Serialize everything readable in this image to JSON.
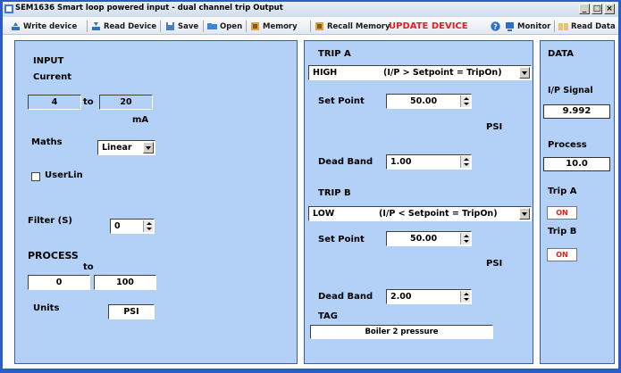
{
  "window": {
    "title": "SEM1636 Smart loop powered input - dual channel trip Output"
  },
  "toolbar": {
    "write_device": "Write device",
    "read_device": "Read Device",
    "save": "Save",
    "open": "Open",
    "memory": "Memory",
    "recall_memory": "Recall Memory",
    "update_device": "UPDATE DEVICE",
    "monitor": "Monitor",
    "read_data": "Read Data"
  },
  "input": {
    "heading": "INPUT",
    "type": "Current",
    "range_low": "4",
    "to_label": "to",
    "range_high": "20",
    "unit": "mA",
    "maths_label": "Maths",
    "maths_value": "Linear",
    "userlin_label": "UserLin",
    "filter_label": "Filter (S)",
    "filter_value": "0"
  },
  "process": {
    "heading": "PROCESS",
    "to_label": "to",
    "low": "0",
    "high": "100",
    "units_label": "Units",
    "units_value": "PSI"
  },
  "trip_a": {
    "heading": "TRIP A",
    "mode": "HIGH",
    "mode_desc": "(I/P > Setpoint = TripOn)",
    "setpoint_label": "Set Point",
    "setpoint_value": "50.00",
    "unit": "PSI",
    "deadband_label": "Dead Band",
    "deadband_value": "1.00"
  },
  "trip_b": {
    "heading": "TRIP B",
    "mode": "LOW",
    "mode_desc": "(I/P < Setpoint = TripOn)",
    "setpoint_label": "Set Point",
    "setpoint_value": "50.00",
    "unit": "PSI",
    "deadband_label": "Dead Band",
    "deadband_value": "2.00"
  },
  "tag": {
    "label": "TAG",
    "value": "Boiler 2 pressure"
  },
  "data": {
    "heading": "DATA",
    "ip_signal_label": "I/P Signal",
    "ip_signal_value": "9.992",
    "process_label": "Process",
    "process_value": "10.0",
    "trip_a_label": "Trip A",
    "trip_a_state": "ON",
    "trip_b_label": "Trip B",
    "trip_b_state": "ON"
  },
  "colors": {
    "frame": "#2a5cc9",
    "panel": "#b3d0f6",
    "alert": "#e02020"
  },
  "icons": [
    "app-icon",
    "write-device-icon",
    "read-device-icon",
    "save-icon",
    "open-icon",
    "memory-icon",
    "recall-memory-icon",
    "help-icon",
    "monitor-icon",
    "read-data-icon",
    "minimize-icon",
    "maximize-icon",
    "close-icon"
  ]
}
